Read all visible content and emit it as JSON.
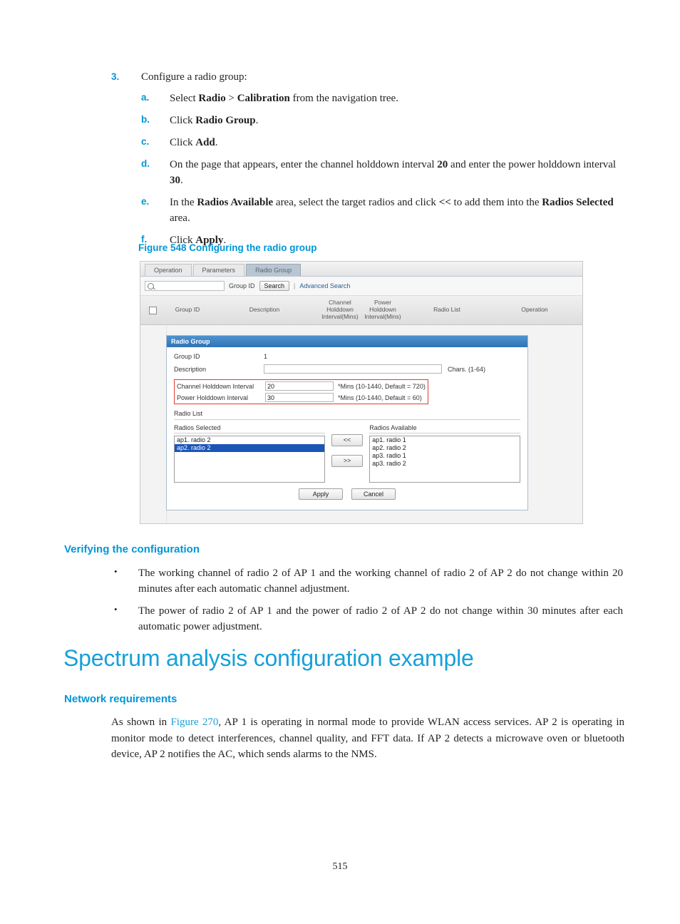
{
  "step": {
    "number": "3.",
    "text": "Configure a radio group:",
    "substeps": [
      {
        "letter": "a.",
        "html": "Select <b>Radio</b> &gt; <b>Calibration</b> from the navigation tree."
      },
      {
        "letter": "b.",
        "html": "Click <b>Radio Group</b>."
      },
      {
        "letter": "c.",
        "html": "Click <b>Add</b>."
      },
      {
        "letter": "d.",
        "html": "On the page that appears, enter the channel holddown interval <b>20</b> and enter the power holddown interval <b>30</b>."
      },
      {
        "letter": "e.",
        "html": "In the <b>Radios Available</b> area, select the target radios and click <b>&lt;&lt;</b> to add them into the <b>Radios Selected</b> area."
      },
      {
        "letter": "f.",
        "html": "Click <b>Apply</b>."
      }
    ]
  },
  "figure": {
    "caption": "Figure 548 Configuring the radio group",
    "tabs": [
      {
        "label": "Operation",
        "active": false
      },
      {
        "label": "Parameters",
        "active": false
      },
      {
        "label": "Radio Group",
        "active": true
      }
    ],
    "searchbar": {
      "input_value": "",
      "group_id_label": "Group ID",
      "search_button": "Search",
      "separator": "|",
      "advanced_search": "Advanced Search"
    },
    "table_headers": {
      "group_id": "Group ID",
      "description": "Description",
      "channel_holddown": "Channel\nHolddown\nInterval(Mins)",
      "channel_holddown_l1": "Channel",
      "channel_holddown_l2": "Holddown",
      "channel_holddown_l3": "Interval(Mins)",
      "power_holddown_l1": "Power",
      "power_holddown_l2": "Holddown",
      "power_holddown_l3": "Interval(Mins)",
      "radio_list": "Radio List",
      "operation": "Operation"
    },
    "panel": {
      "title": "Radio Group",
      "group_id_label": "Group ID",
      "group_id_value": "1",
      "description_label": "Description",
      "description_value": "",
      "chars_note": "Chars. (1-64)",
      "channel_holddown_label": "Channel Holddown Interval",
      "channel_holddown_value": "20",
      "channel_holddown_hint": "*Mins (10-1440, Default = 720)",
      "power_holddown_label": "Power Holddown Interval",
      "power_holddown_value": "30",
      "power_holddown_hint": "*Mins (10-1440, Default = 60)",
      "radio_list_label": "Radio List",
      "radios_selected_label": "Radios Selected",
      "radios_selected": [
        {
          "label": "ap1. radio 2",
          "selected": false
        },
        {
          "label": "ap2. radio 2",
          "selected": true
        }
      ],
      "radios_available_label": "Radios Available",
      "radios_available": [
        {
          "label": "ap1. radio 1",
          "selected": false
        },
        {
          "label": "ap2. radio 2",
          "selected": false
        },
        {
          "label": "ap3. radio 1",
          "selected": false
        },
        {
          "label": "ap3. radio 2",
          "selected": false
        }
      ],
      "move_left_button": "<<",
      "move_right_button": ">>",
      "apply_button": "Apply",
      "cancel_button": "Cancel"
    }
  },
  "verifying": {
    "heading": "Verifying the configuration",
    "bullets": [
      "The working channel of radio 2 of AP 1 and the working channel of radio 2 of AP 2 do not change within 20 minutes after each automatic channel adjustment.",
      "The power of radio 2 of AP 1 and the power of radio 2 of AP 2 do not change within 30 minutes after each automatic power adjustment."
    ]
  },
  "section": {
    "h1": "Spectrum analysis configuration example",
    "h2": "Network requirements",
    "paragraph_pre": "As shown in ",
    "paragraph_link": "Figure 270",
    "paragraph_post": ", AP 1 is operating in normal mode to provide WLAN access services. AP 2 is operating in monitor mode to detect interferences, channel quality, and FFT data. If AP 2 detects a microwave oven or bluetooth device, AP 2 notifies the AC, which sends alarms to the NMS."
  },
  "page_number": "515",
  "colors": {
    "accent": "#0096d6",
    "heading": "#17a0d8",
    "text": "#231f20",
    "panel_blue": "#2f73b6",
    "highlight_red": "#e23b2e",
    "list_selected": "#1b55b8"
  }
}
